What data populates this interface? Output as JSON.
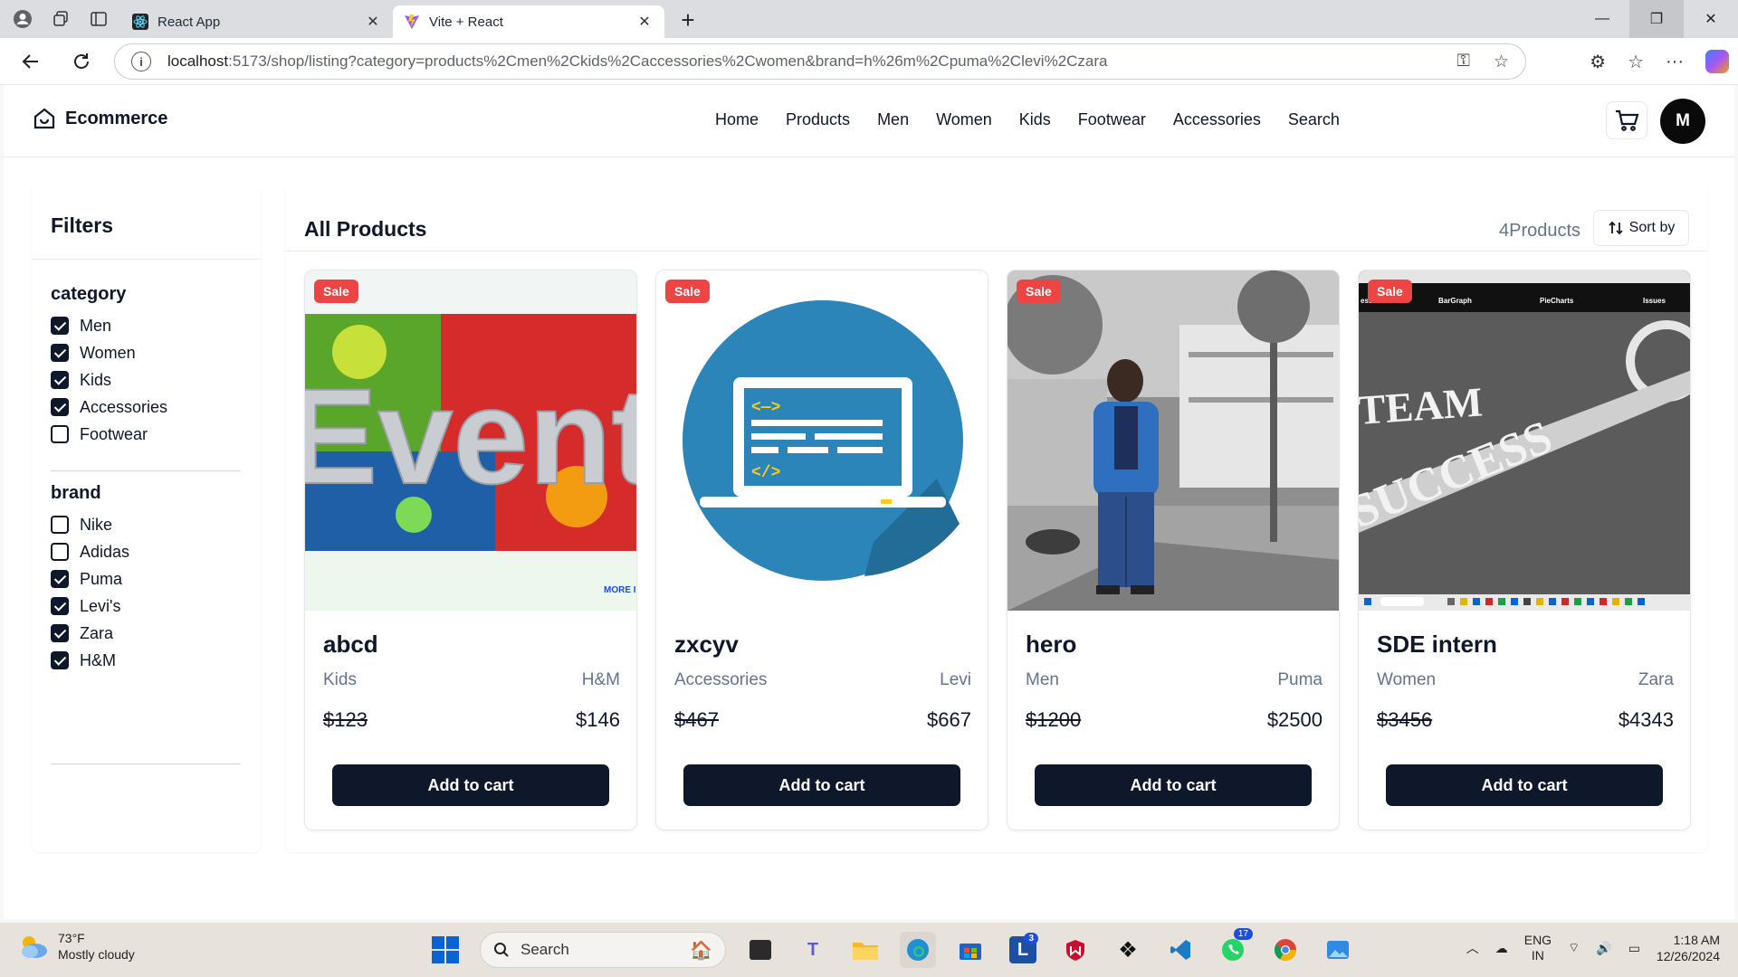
{
  "browser": {
    "tabs": [
      {
        "title": "React App",
        "active": false
      },
      {
        "title": "Vite + React",
        "active": true
      }
    ],
    "url_host": "localhost",
    "url_rest": ":5173/shop/listing?category=products%2Cmen%2Ckids%2Caccessories%2Cwomen&brand=h%26m%2Cpuma%2Clevi%2Czara"
  },
  "header": {
    "logo": "Ecommerce",
    "nav": [
      "Home",
      "Products",
      "Men",
      "Women",
      "Kids",
      "Footwear",
      "Accessories",
      "Search"
    ],
    "avatar_initial": "M"
  },
  "filters": {
    "title": "Filters",
    "category_title": "category",
    "categories": [
      {
        "label": "Men",
        "checked": true
      },
      {
        "label": "Women",
        "checked": true
      },
      {
        "label": "Kids",
        "checked": true
      },
      {
        "label": "Accessories",
        "checked": true
      },
      {
        "label": "Footwear",
        "checked": false
      }
    ],
    "brand_title": "brand",
    "brands": [
      {
        "label": "Nike",
        "checked": false
      },
      {
        "label": "Adidas",
        "checked": false
      },
      {
        "label": "Puma",
        "checked": true
      },
      {
        "label": "Levi's",
        "checked": true
      },
      {
        "label": "Zara",
        "checked": true
      },
      {
        "label": "H&M",
        "checked": true
      }
    ]
  },
  "listing": {
    "title": "All Products",
    "count": "4Products",
    "sort_label": "Sort by",
    "products": [
      {
        "name": "abcd",
        "category": "Kids",
        "brand": "H&M",
        "price": "$123",
        "sale_price": "$146",
        "badge": "Sale",
        "button": "Add to cart"
      },
      {
        "name": "zxcyv",
        "category": "Accessories",
        "brand": "Levi",
        "price": "$467",
        "sale_price": "$667",
        "badge": "Sale",
        "button": "Add to cart"
      },
      {
        "name": "hero",
        "category": "Men",
        "brand": "Puma",
        "price": "$1200",
        "sale_price": "$2500",
        "badge": "Sale",
        "button": "Add to cart"
      },
      {
        "name": "SDE intern",
        "category": "Women",
        "brand": "Zara",
        "price": "$3456",
        "sale_price": "$4343",
        "badge": "Sale",
        "button": "Add to cart"
      }
    ]
  },
  "image_text": {
    "event": "Event!",
    "more": "MORE I",
    "team": "TEAM",
    "success": "SUCCESS",
    "mini_nav": [
      "ess",
      "BarGraph",
      "PieCharts",
      "Issues"
    ]
  },
  "taskbar": {
    "temp": "73°F",
    "weather": "Mostly cloudy",
    "search": "Search",
    "lang1": "ENG",
    "lang2": "IN",
    "time": "1:18 AM",
    "date": "12/26/2024",
    "badges": {
      "outlook": "3",
      "whatsapp": "17"
    }
  },
  "colors": {
    "primary": "#0f172a",
    "sale": "#ef4444",
    "muted": "#64748b"
  }
}
